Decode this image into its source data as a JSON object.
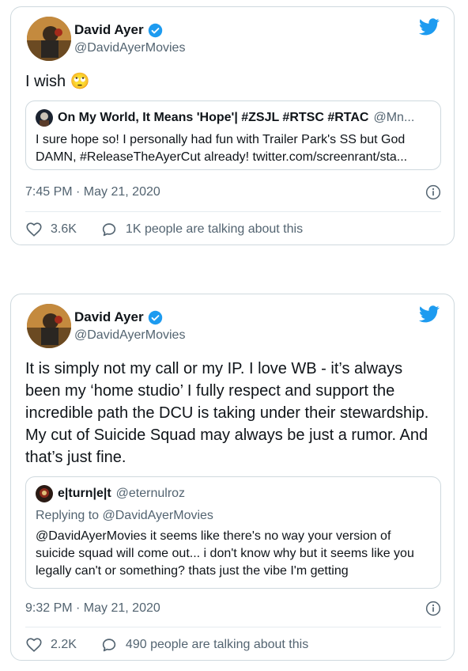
{
  "tweets": [
    {
      "author_name": "David Ayer",
      "author_handle": "@DavidAyerMovies",
      "text": "I wish",
      "emoji": "🙄",
      "quote": {
        "name": "On My World, It Means 'Hope'| #ZSJL #RTSC #RTAC",
        "handle": "@Mn...",
        "text": "I sure hope so! I personally had fun with Trailer Park's SS but God DAMN, #ReleaseTheAyerCut already! twitter.com/screenrant/sta..."
      },
      "timestamp": "7:45 PM · May 21, 2020",
      "likes": "3.6K",
      "talking": "1K people are talking about this"
    },
    {
      "author_name": "David Ayer",
      "author_handle": "@DavidAyerMovies",
      "text": "It is simply not my call or my IP. I love WB - it’s always been my ‘home studio’ I fully respect and support the incredible path the DCU is taking under their stewardship. My cut of Suicide Squad may always be just a rumor. And that’s just fine.",
      "quote": {
        "name": "e|turn|e|t",
        "handle": "@eternulroz",
        "replying": "Replying to @DavidAyerMovies",
        "text": "@DavidAyerMovies it seems like there's no way your version of suicide squad will come out... i don't know why but it seems like you legally can't or something? thats just the vibe I'm getting"
      },
      "timestamp": "9:32 PM · May 21, 2020",
      "likes": "2.2K",
      "talking": "490 people are talking about this"
    }
  ],
  "colors": {
    "accent": "#1d9bf0",
    "secondary_text": "#536471",
    "border": "#cfd9de"
  },
  "icons": [
    "twitter-bird-icon",
    "verified-badge-icon",
    "info-icon",
    "heart-icon",
    "comment-icon"
  ]
}
